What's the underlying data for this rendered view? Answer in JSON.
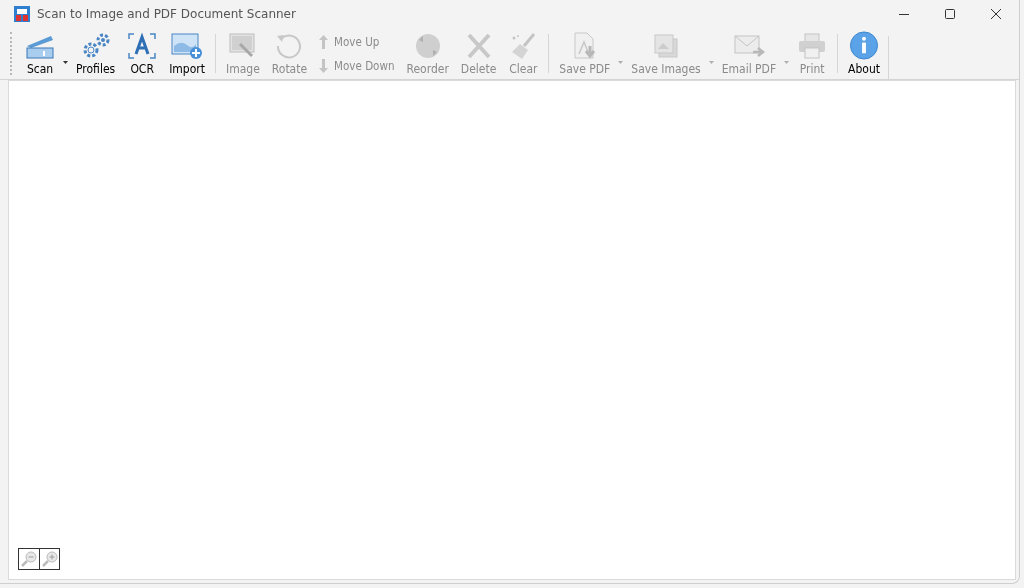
{
  "window": {
    "title": "Scan to Image and PDF Document Scanner"
  },
  "toolbar": [
    {
      "kind": "button",
      "label": "Scan",
      "disabled": false,
      "dropdown": true
    },
    {
      "kind": "button",
      "label": "Profiles",
      "disabled": false,
      "dropdown": false
    },
    {
      "kind": "button",
      "label": "OCR",
      "disabled": false,
      "dropdown": false
    },
    {
      "kind": "button",
      "label": "Import",
      "disabled": false,
      "dropdown": false
    },
    {
      "kind": "separator"
    },
    {
      "kind": "button",
      "label": "Image",
      "disabled": true,
      "dropdown": false
    },
    {
      "kind": "button",
      "label": "Rotate",
      "disabled": true,
      "dropdown": false
    },
    {
      "kind": "stack",
      "items": [
        {
          "label": "Move Up",
          "disabled": true
        },
        {
          "label": "Move Down",
          "disabled": true
        }
      ]
    },
    {
      "kind": "button",
      "label": "Reorder",
      "disabled": true,
      "dropdown": false
    },
    {
      "kind": "button",
      "label": "Delete",
      "disabled": true,
      "dropdown": false
    },
    {
      "kind": "button",
      "label": "Clear",
      "disabled": true,
      "dropdown": false
    },
    {
      "kind": "separator"
    },
    {
      "kind": "button",
      "label": "Save PDF",
      "disabled": true,
      "dropdown": true
    },
    {
      "kind": "button",
      "label": "Save Images",
      "disabled": true,
      "dropdown": true
    },
    {
      "kind": "button",
      "label": "Email PDF",
      "disabled": true,
      "dropdown": true
    },
    {
      "kind": "button",
      "label": "Print",
      "disabled": true,
      "dropdown": false
    },
    {
      "kind": "separator"
    },
    {
      "kind": "button",
      "label": "About",
      "disabled": false,
      "dropdown": false
    }
  ]
}
